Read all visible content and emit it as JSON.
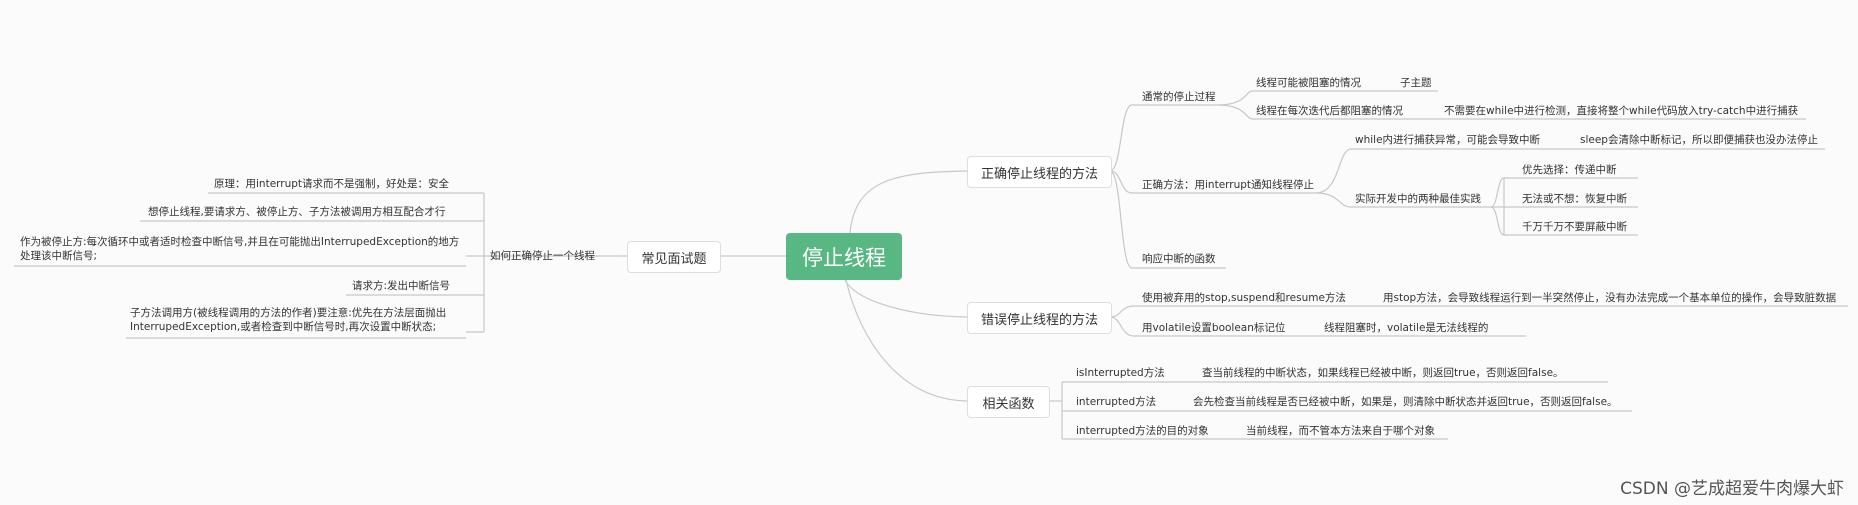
{
  "central": "停止线程",
  "main_topics": {
    "correct": "正确停止线程的方法",
    "wrong": "错误停止线程的方法",
    "related": "相关函数",
    "interview": "常见面试题"
  },
  "correct": {
    "usual": {
      "label": "通常的停止过程",
      "blocked": "线程可能被阻塞的情况",
      "blocked_sub": "子主题",
      "each_iter": "线程在每次迭代后都阻塞的情况",
      "each_iter_sub": "不需要在while中进行检测，直接将整个while代码放入try-catch中进行捕获"
    },
    "right_way": {
      "label": "正确方法：用interrupt通知线程停止",
      "while_catch": "while内进行捕获异常，可能会导致中断",
      "while_catch_sub": "sleep会清除中断标记，所以即便捕获也没办法停止",
      "best": "实际开发中的两种最佳实践",
      "best_items": [
        "优先选择：传递中断",
        "无法或不想：恢复中断",
        "千万千万不要屏蔽中断"
      ]
    },
    "respond": "响应中断的函数"
  },
  "wrong": {
    "stop": "使用被弃用的stop,suspend和resume方法",
    "stop_sub": "用stop方法，会导致线程运行到一半突然停止，没有办法完成一个基本单位的操作，会导致脏数据",
    "volatile": "用volatile设置boolean标记位",
    "volatile_sub": "线程阻塞时，volatile是无法线程的"
  },
  "related": {
    "items": [
      {
        "name": "isInterrupted方法",
        "desc": "查当前线程的中断状态，如果线程已经被中断，则返回true，否则返回false。"
      },
      {
        "name": "interrupted方法",
        "desc": "会先检查当前线程是否已经被中断，如果是，则清除中断状态并返回true，否则返回false。"
      },
      {
        "name": "interrupted方法的目的对象",
        "desc": "当前线程，而不管本方法来自于哪个对象"
      }
    ]
  },
  "interview": {
    "question": "如何正确停止一个线程",
    "answers": [
      "原理：用interrupt请求而不是强制，好处是：安全",
      "想停止线程,要请求方、被停止方、子方法被调用方相互配合才行",
      "作为被停止方:每次循环中或者适时检查中断信号,并且在可能抛出InterrupedException的地方处理该中断信号;",
      "请求方:发出中断信号",
      "子方法调用方(被线程调用的方法的作者)要注意:优先在方法层面抛出InterrupedException,或者检查到中断信号时,再次设置中断状态;"
    ]
  },
  "watermark": "CSDN @艺成超爱牛肉爆大虾",
  "colors": {
    "central": "#59b784",
    "line": "#c8c8c8",
    "background": "#fbfbfb"
  }
}
